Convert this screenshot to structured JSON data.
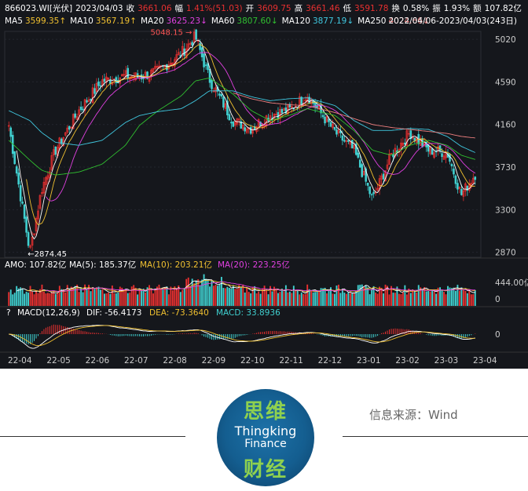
{
  "header": {
    "code": "866023.WI[光伏]",
    "date": "2023/04/03",
    "close_label": "收",
    "close": "3661.06",
    "change_label": "幅",
    "change": "1.41%(51.03)",
    "open_label": "开",
    "open": "3609.75",
    "high_label": "高",
    "high": "3661.46",
    "low_label": "低",
    "low": "3591.78",
    "turnover_label": "换",
    "turnover": "0.58%",
    "amplitude_label": "振",
    "amplitude": "1.93%",
    "amount_label": "额",
    "amount": "107.82亿"
  },
  "ma_legend": [
    {
      "label": "MA5",
      "value": "3599.35↑",
      "color": "#ffffff",
      "vcolor": "#f0c030"
    },
    {
      "label": "MA10",
      "value": "3567.19↑",
      "color": "#ffffff",
      "vcolor": "#f0c030"
    },
    {
      "label": "MA20",
      "value": "3625.23↓",
      "color": "#ffffff",
      "vcolor": "#e040e0"
    },
    {
      "label": "MA60",
      "value": "3807.60↓",
      "color": "#ffffff",
      "vcolor": "#30c030"
    },
    {
      "label": "MA120",
      "value": "3877.19↓",
      "color": "#ffffff",
      "vcolor": "#40c8e0"
    },
    {
      "label": "MA250",
      "value": "4024.66↓",
      "color": "#ffffff",
      "vcolor": "#f08080"
    }
  ],
  "range": "2022/04/06-2023/04/03(243日)",
  "price_axis": [
    "5020",
    "4590",
    "4160",
    "3730",
    "3300",
    "2870"
  ],
  "annotations": {
    "high": "5048.15",
    "low": "2874.45"
  },
  "amo": {
    "title": "AMO: 107.82亿",
    "ma5": "MA(5): 185.37亿",
    "ma10": "MA(10): 203.21亿",
    "ma20": "MA(20): 223.25亿",
    "axis_top": "444.00亿",
    "axis_zero": "0"
  },
  "macd": {
    "title": "MACD(12,26,9)",
    "dif": "DIF: -56.4173",
    "dea": "DEA: -73.3640",
    "macd": "MACD: 33.8936",
    "axis_zero": "0"
  },
  "x_axis": [
    "22-04",
    "22-05",
    "22-06",
    "22-07",
    "22-08",
    "22-09",
    "22-10",
    "22-11",
    "22-12",
    "23-01",
    "23-02",
    "23-03",
    "23-04"
  ],
  "colors": {
    "up": "#e83030",
    "down": "#40d0d0",
    "ma5": "#ffffff",
    "ma10": "#f0c030",
    "ma20": "#e040e0",
    "ma60": "#30c030",
    "ma120": "#40c8e0",
    "ma250": "#f08080"
  },
  "footer": {
    "logo_top": "思维",
    "logo_mid": "Thingking",
    "logo_mid2": "Finance",
    "logo_bot": "财经",
    "source": "信息来源：Wind"
  },
  "chart_data": {
    "type": "candlestick",
    "keypoints_x": [
      0,
      0.045,
      0.07,
      0.1,
      0.15,
      0.2,
      0.25,
      0.28,
      0.32,
      0.37,
      0.4,
      0.43,
      0.48,
      0.52,
      0.56,
      0.6,
      0.64,
      0.7,
      0.74,
      0.78,
      0.82,
      0.86,
      0.9,
      0.94,
      0.97,
      1.0
    ],
    "close_path": [
      4150,
      2874,
      3500,
      3900,
      4300,
      4600,
      4650,
      4640,
      4700,
      4880,
      5048,
      4620,
      4200,
      4120,
      4260,
      4300,
      4460,
      4080,
      3900,
      3400,
      3850,
      4080,
      3900,
      3880,
      3450,
      3661
    ],
    "ma120_path": [
      4300,
      4200,
      4080,
      3980,
      3950,
      4000,
      4180,
      4250,
      4290,
      4320,
      4400,
      4500,
      4500,
      4440,
      4400,
      4420,
      4430,
      4350,
      4200,
      4100,
      4100,
      4120,
      4110,
      4040,
      3940,
      3877
    ],
    "ma250_path": [
      null,
      null,
      null,
      null,
      null,
      null,
      null,
      null,
      null,
      null,
      null,
      null,
      4480,
      4420,
      4380,
      4360,
      4350,
      4280,
      4220,
      4160,
      4130,
      4110,
      4090,
      4070,
      4040,
      4024
    ],
    "ma60_path": [
      4000,
      3800,
      3700,
      3650,
      3680,
      3760,
      3950,
      4150,
      4300,
      4450,
      4600,
      4630,
      4470,
      4300,
      4200,
      4250,
      4320,
      4250,
      4100,
      3900,
      3850,
      3950,
      4000,
      3950,
      3850,
      3807
    ]
  }
}
